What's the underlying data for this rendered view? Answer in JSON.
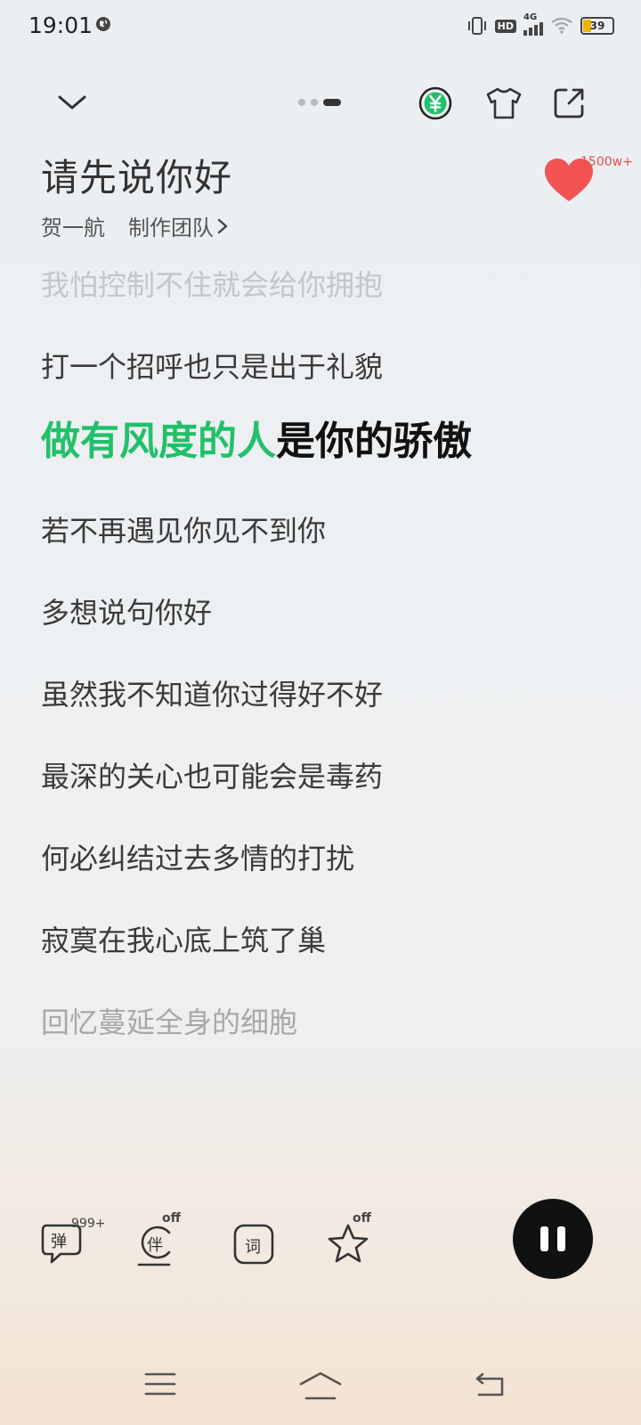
{
  "status_bar": {
    "time": "19:01",
    "hd": "HD",
    "network": "4G",
    "battery": "39"
  },
  "top_bar": {
    "icons": [
      "chevron-down-icon",
      "vip-yuan-icon",
      "tshirt-icon",
      "share-icon"
    ],
    "page_dots": 3,
    "active_dot": 3
  },
  "song": {
    "title": "请先说你好",
    "artist": "贺一航",
    "credits": "制作团队",
    "like_count": "1500w+"
  },
  "lyrics": {
    "lines": [
      {
        "text": "我怕控制不住就会给你拥抱",
        "state": "faded-top"
      },
      {
        "text": "打一个招呼也只是出于礼貌",
        "state": "normal"
      },
      {
        "sung": "做有风度的人",
        "unsung": "是你的骄傲",
        "state": "current"
      },
      {
        "text": "若不再遇见你见不到你",
        "state": "normal"
      },
      {
        "text": "多想说句你好",
        "state": "normal"
      },
      {
        "text": "虽然我不知道你过得好不好",
        "state": "normal"
      },
      {
        "text": "最深的关心也可能会是毒药",
        "state": "normal"
      },
      {
        "text": "何必纠结过去多情的打扰",
        "state": "normal"
      },
      {
        "text": "寂寞在我心底上筑了巢",
        "state": "normal"
      },
      {
        "text": "回忆蔓延全身的细胞",
        "state": "faded-bottom"
      }
    ],
    "highlight_color": "#22c06a"
  },
  "controls": {
    "danmaku_label": "弹",
    "danmaku_count": "999+",
    "accompaniment_label": "伴",
    "accompaniment_state": "off",
    "lyrics_label": "词",
    "effect_state": "off"
  }
}
